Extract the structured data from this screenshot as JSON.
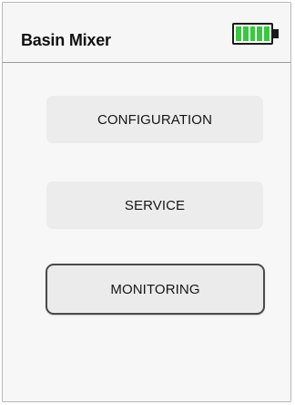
{
  "header": {
    "title": "Basin Mixer",
    "battery_icon": "battery-full-icon",
    "battery_color": "#3ac840",
    "battery_level": 1.0
  },
  "menu": {
    "items": [
      {
        "label": "CONFIGURATION",
        "selected": false
      },
      {
        "label": "SERVICE",
        "selected": false
      },
      {
        "label": "MONITORING",
        "selected": true
      }
    ]
  }
}
